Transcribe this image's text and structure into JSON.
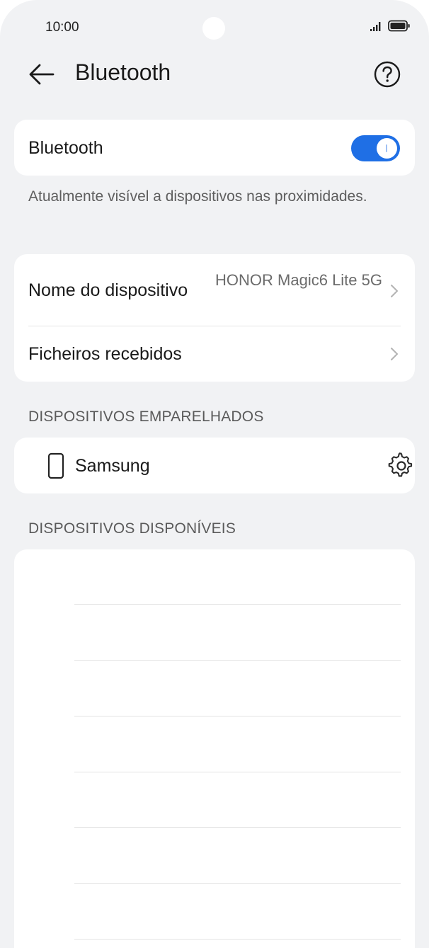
{
  "status_bar": {
    "time": "10:00"
  },
  "header": {
    "title": "Bluetooth"
  },
  "bluetooth_card": {
    "label": "Bluetooth",
    "toggle_on": true
  },
  "visibility_text": "Atualmente visível a dispositivos nas proximidades.",
  "settings_card": {
    "device_name_label": "Nome do dispositivo",
    "device_name_value": "HONOR Magic6 Lite 5G",
    "received_files_label": "Ficheiros recebidos"
  },
  "paired_section": {
    "title": "DISPOSITIVOS EMPARELHADOS",
    "devices": [
      {
        "name": "Samsung",
        "icon": "phone-icon"
      }
    ]
  },
  "available_section": {
    "title": "DISPOSITIVOS DISPONÍVEIS"
  },
  "colors": {
    "accent": "#1f6fe5",
    "background": "#f1f2f4",
    "card": "#ffffff"
  }
}
